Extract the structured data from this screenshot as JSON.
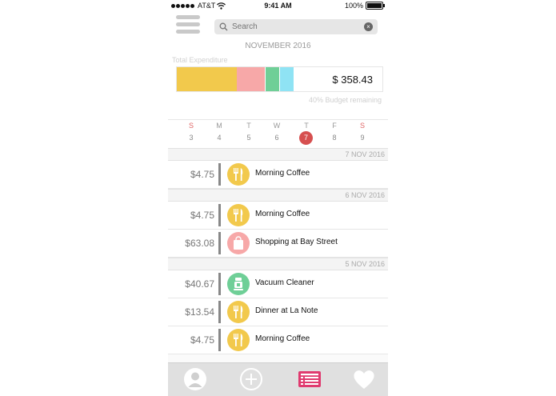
{
  "status": {
    "carrier": "AT&T",
    "time": "9:41 AM",
    "battery": "100%"
  },
  "search": {
    "placeholder": "Search"
  },
  "month": "NOVEMBER 2016",
  "expenditure": {
    "label": "Total Expenditure",
    "amount": "$ 358.43",
    "budget_note": "40% Budget remaining",
    "segments": [
      {
        "category": "food",
        "fraction": 0.29,
        "color": "#f2c94c"
      },
      {
        "category": "shopping",
        "fraction": 0.14,
        "color": "#f7a8a8"
      },
      {
        "category": "appliances",
        "fraction": 0.07,
        "color": "#6fcf97"
      },
      {
        "category": "other",
        "fraction": 0.07,
        "color": "#8fe3f4"
      }
    ]
  },
  "calendar": {
    "days": [
      "S",
      "M",
      "T",
      "W",
      "T",
      "F",
      "S"
    ],
    "dates": [
      "3",
      "4",
      "5",
      "6",
      "7",
      "8",
      "9"
    ],
    "selected_index": 4
  },
  "groups": [
    {
      "date": "7 NOV 2016",
      "items": [
        {
          "amount": "$4.75",
          "label": "Morning Coffee",
          "icon": "fork-knife-icon",
          "color": "#f2c94c"
        }
      ]
    },
    {
      "date": "6 NOV 2016",
      "items": [
        {
          "amount": "$4.75",
          "label": "Morning Coffee",
          "icon": "fork-knife-icon",
          "color": "#f2c94c"
        },
        {
          "amount": "$63.08",
          "label": "Shopping at Bay Street",
          "icon": "shopping-bag-icon",
          "color": "#f7a8a8"
        }
      ]
    },
    {
      "date": "5 NOV 2016",
      "items": [
        {
          "amount": "$40.67",
          "label": "Vacuum Cleaner",
          "icon": "vacuum-icon",
          "color": "#6fcf97"
        },
        {
          "amount": "$13.54",
          "label": "Dinner at La Note",
          "icon": "fork-knife-icon",
          "color": "#f2c94c"
        },
        {
          "amount": "$4.75",
          "label": "Morning Coffee",
          "icon": "fork-knife-icon",
          "color": "#f2c94c"
        }
      ]
    }
  ],
  "tabs": [
    {
      "name": "profile",
      "icon": "person-icon"
    },
    {
      "name": "add",
      "icon": "plus-icon"
    },
    {
      "name": "list",
      "icon": "list-icon",
      "active": true,
      "color": "#e03a6f"
    },
    {
      "name": "favorites",
      "icon": "heart-icon"
    }
  ]
}
